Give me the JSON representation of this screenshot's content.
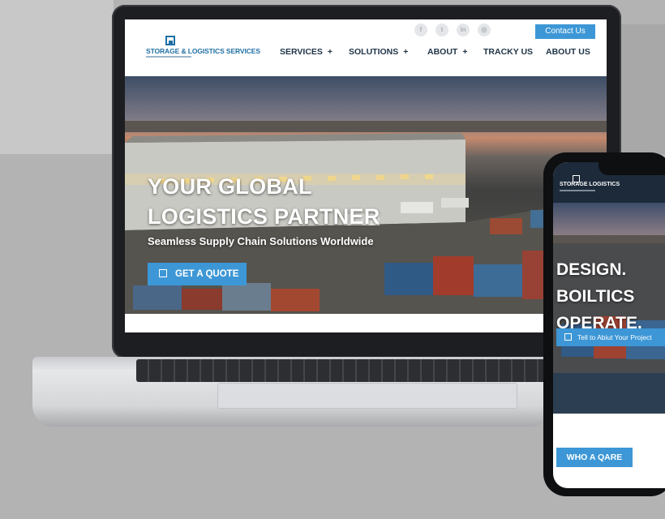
{
  "laptop": {
    "logo": {
      "text": "STORAGE & LOGISTICS SERVICES"
    },
    "social_icons": [
      "facebook-icon",
      "twitter-icon",
      "linkedin-icon",
      "instagram-icon"
    ],
    "social_glyphs": [
      "f",
      "t",
      "in",
      "◎"
    ],
    "contact_label": "Contact Us",
    "nav": [
      {
        "label": "SERVICES",
        "has_plus": true,
        "plus": "+"
      },
      {
        "label": "SOLUTIONS",
        "has_plus": true,
        "plus": "+"
      },
      {
        "label": "ABOUT",
        "has_plus": true,
        "plus": "+"
      },
      {
        "label": "TRACKY US",
        "has_plus": false
      },
      {
        "label": "ABOUT US",
        "has_plus": false
      }
    ],
    "hero": {
      "title_line1": "YOUR GLOBAL",
      "title_line2": "LOGISTICS PARTNER",
      "subtitle": "Seamless Supply Chain Solutions Worldwide",
      "cta_label": "GET A QUOTE"
    }
  },
  "phone": {
    "logo_text": "STORAGE LOGISTICS",
    "hero": {
      "line1": "DESIGN.",
      "line2": "BOILTICS",
      "line3": "OPERATE.",
      "cta_label": "Tell to Abiut Your Project"
    },
    "button_label": "WHO A QARE"
  },
  "colors": {
    "accent": "#3d97d6",
    "navy": "#1f3447",
    "logo_blue": "#1f6fa3"
  }
}
